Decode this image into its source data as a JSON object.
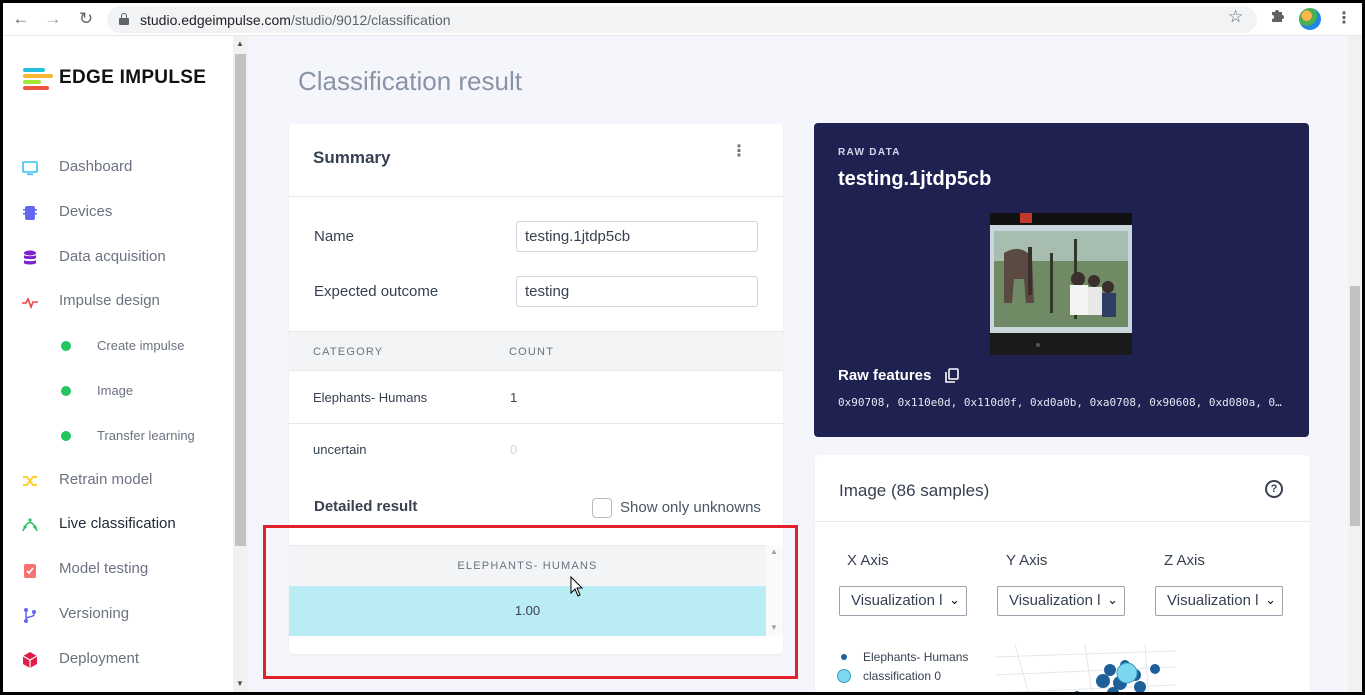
{
  "browser": {
    "url_host": "studio.edgeimpulse.com",
    "url_path": "/studio/9012/classification",
    "back_icon": "back-arrow-icon",
    "forward_icon": "forward-arrow-icon",
    "reload_icon": "reload-icon"
  },
  "brand": {
    "name": "EDGE IMPULSE"
  },
  "sidebar": {
    "items": [
      {
        "label": "Dashboard",
        "icon": "monitor-icon",
        "color": "#38bdf8"
      },
      {
        "label": "Devices",
        "icon": "chip-icon",
        "color": "#6366f1"
      },
      {
        "label": "Data acquisition",
        "icon": "database-icon",
        "color": "#7e22ce"
      },
      {
        "label": "Impulse design",
        "icon": "pulse-icon",
        "color": "#ef4444"
      },
      {
        "label": "Retrain model",
        "icon": "shuffle-icon",
        "color": "#facc15"
      },
      {
        "label": "Live classification",
        "icon": "live-icon",
        "color": "#22c55e"
      },
      {
        "label": "Model testing",
        "icon": "clipboard-check-icon",
        "color": "#f87171"
      },
      {
        "label": "Versioning",
        "icon": "branch-icon",
        "color": "#6366f1"
      },
      {
        "label": "Deployment",
        "icon": "package-icon",
        "color": "#e11d48"
      }
    ],
    "subitems": [
      {
        "label": "Create impulse"
      },
      {
        "label": "Image"
      },
      {
        "label": "Transfer learning"
      }
    ]
  },
  "page": {
    "title": "Classification result"
  },
  "summary": {
    "title": "Summary",
    "name_label": "Name",
    "name_value": "testing.1jtdp5cb",
    "expected_label": "Expected outcome",
    "expected_value": "testing",
    "col_category": "CATEGORY",
    "col_count": "COUNT",
    "rows": [
      {
        "category": "Elephants- Humans",
        "count": "1"
      },
      {
        "category": "uncertain",
        "count": "0"
      }
    ],
    "detailed_title": "Detailed result",
    "show_unknowns_label": "Show only unknowns",
    "detail_column": "ELEPHANTS- HUMANS",
    "detail_value": "1.00"
  },
  "raw": {
    "kicker": "RAW DATA",
    "title": "testing.1jtdp5cb",
    "features_label": "Raw features",
    "features_values": "0x90708, 0x110e0d, 0x110d0f, 0xd0a0b, 0xa0708, 0x90608, 0xd080a, 0…"
  },
  "image_panel": {
    "title": "Image (86 samples)",
    "x_axis_label": "X Axis",
    "y_axis_label": "Y Axis",
    "z_axis_label": "Z Axis",
    "x_select": "Visualization l",
    "y_select": "Visualization l",
    "z_select": "Visualization l",
    "legend": [
      {
        "label": "Elephants- Humans",
        "color": "#1f5f99"
      },
      {
        "label": "classification 0",
        "color": "#7dd8ef"
      }
    ]
  },
  "colors": {
    "accent": "#1f2150",
    "highlight": "#b9ecf5",
    "annotation": "#e3202a"
  }
}
